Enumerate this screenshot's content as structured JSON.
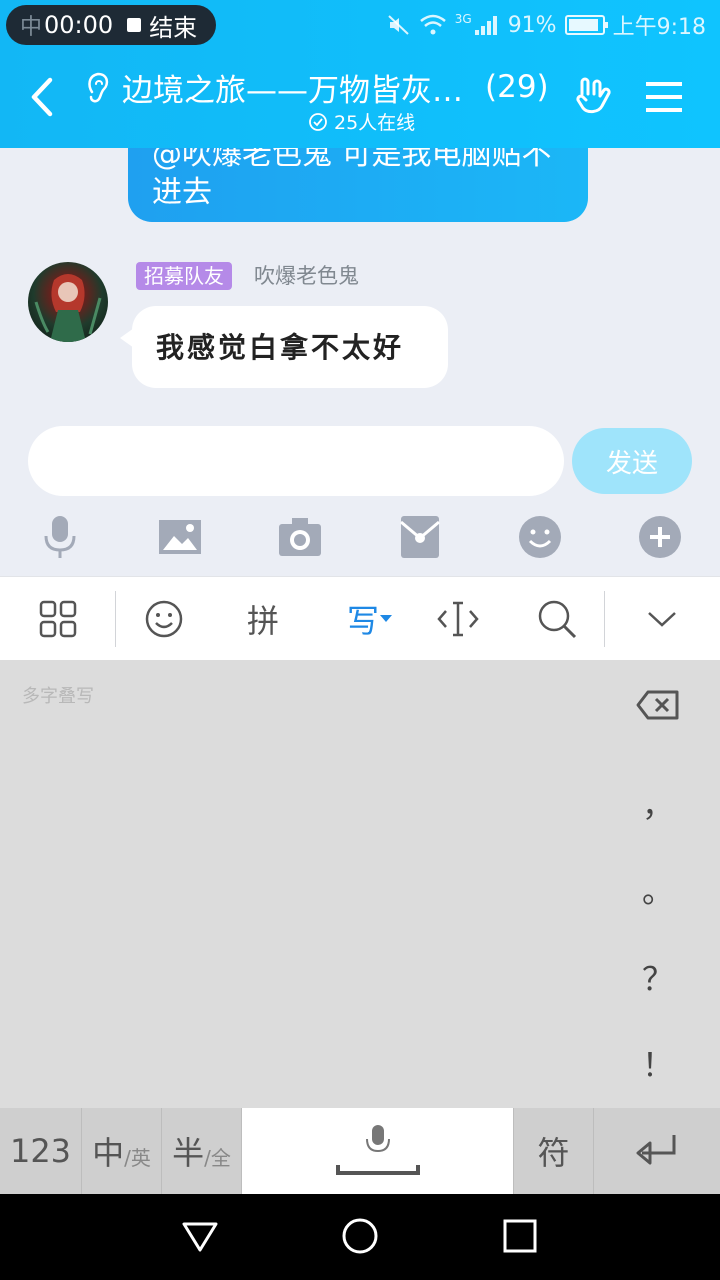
{
  "status_bar": {
    "ime_indicator": "中",
    "recording_time": "00:00",
    "recording_end_label": "结束",
    "battery_percent": "91%",
    "battery_level": 0.91,
    "clock": "上午9:18",
    "network_label": "3G"
  },
  "header": {
    "title": "边境之旅——万物皆灰…",
    "member_count": "(29)",
    "online_text": "25人在线",
    "accent_color": "#12b7f5"
  },
  "messages": {
    "mine_partial": "@吹爆老色鬼 可是我电脑贴不进去",
    "other": {
      "badge": "招募队友",
      "sender": "吹爆老色鬼",
      "text": "我感觉白拿不太好"
    }
  },
  "input": {
    "value": "",
    "send_label": "发送"
  },
  "tools": [
    "mic-icon",
    "image-icon",
    "camera-icon",
    "red-packet-icon",
    "emoji-icon",
    "plus-icon"
  ],
  "keyboard_toolbar": {
    "pinyin_label": "拼",
    "handwrite_label": "写",
    "active_color": "#1e88e5"
  },
  "handwriting": {
    "hint": "多字叠写",
    "punctuation": [
      "，",
      "。",
      "？",
      "！"
    ]
  },
  "keys": {
    "num": "123",
    "lang_main": "中",
    "lang_sub": "/英",
    "width_main": "半",
    "width_sub": "/全",
    "symbol": "符"
  }
}
